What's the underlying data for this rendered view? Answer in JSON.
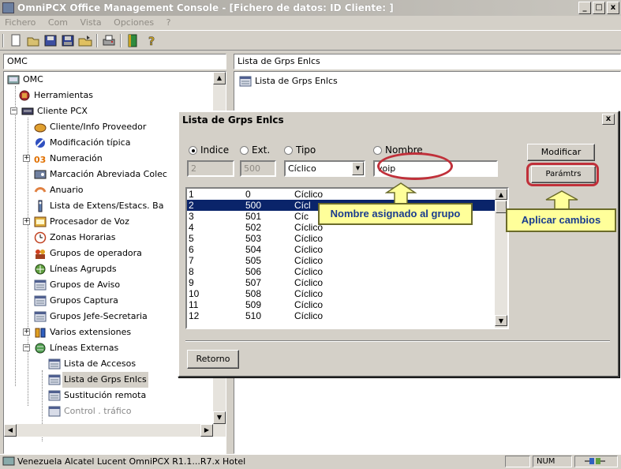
{
  "window": {
    "title": "OmniPCX Office Management Console - [Fichero de datos:     ID Cliente: ]",
    "min": "_",
    "max": "□",
    "close": "x"
  },
  "menu": [
    "Fichero",
    "Com",
    "Vista",
    "Opciones",
    "?"
  ],
  "toolbar": [
    "new-doc-icon",
    "open-folder-icon",
    "save-icon",
    "save-all-icon",
    "open-icon",
    "print-icon",
    "book-icon",
    "help-icon"
  ],
  "left_header": "OMC",
  "right_header": "Lista de Grps Enlcs",
  "tree": {
    "root": "OMC",
    "items": [
      {
        "label": "Herramientas",
        "icon": "tools-icon"
      },
      {
        "label": "Cliente PCX",
        "icon": "pcx-icon"
      },
      {
        "label": "Cliente/Info Proveedor",
        "icon": "info-icon"
      },
      {
        "label": "Modificación típica",
        "icon": "modify-icon"
      },
      {
        "label": "Numeración",
        "icon": "numbering-icon"
      },
      {
        "label": "Marcación Abreviada Colec",
        "icon": "speed-dial-icon"
      },
      {
        "label": "Anuario",
        "icon": "directory-icon"
      },
      {
        "label": "Lista de Extens/Estacs. Ba",
        "icon": "extensions-icon"
      },
      {
        "label": "Procesador de Voz",
        "icon": "voice-processor-icon"
      },
      {
        "label": "Zonas Horarias",
        "icon": "clock-icon"
      },
      {
        "label": "Grupos de operadora",
        "icon": "operator-group-icon"
      },
      {
        "label": "Líneas Agrupds",
        "icon": "grouped-lines-icon"
      },
      {
        "label": "Grupos de Aviso",
        "icon": "list-icon"
      },
      {
        "label": "Grupos Captura",
        "icon": "list-icon"
      },
      {
        "label": "Grupos Jefe-Secretaria",
        "icon": "list-icon"
      },
      {
        "label": "Varios extensiones",
        "icon": "multi-extension-icon"
      },
      {
        "label": "Líneas Externas",
        "icon": "external-lines-icon"
      },
      {
        "label": "Lista de Accesos",
        "icon": "list-icon"
      },
      {
        "label": "Lista de Grps Enlcs",
        "icon": "list-icon"
      },
      {
        "label": "Sustitución remota",
        "icon": "list-icon"
      },
      {
        "label": "Control . tráfico",
        "icon": "list-icon"
      }
    ]
  },
  "right_pane": {
    "item": "Lista de Grps Enlcs"
  },
  "dialog": {
    "title": "Lista de Grps Enlcs",
    "close": "x",
    "radios": [
      "Indice",
      "Ext.",
      "Tipo",
      "Nombre"
    ],
    "selected_radio": "Indice",
    "fields": {
      "indice": "2",
      "ext": "500",
      "tipo": "Cíclico",
      "nombre": "voip"
    },
    "buttons": {
      "modificar": "Modificar",
      "paramtrs": "Parámtrs",
      "retorno": "Retorno"
    },
    "rows": [
      {
        "i": "1",
        "ext": "0",
        "tipo": "Cíclico"
      },
      {
        "i": "2",
        "ext": "500",
        "tipo": "Cícl"
      },
      {
        "i": "3",
        "ext": "501",
        "tipo": "Cíc"
      },
      {
        "i": "4",
        "ext": "502",
        "tipo": "Cíclico"
      },
      {
        "i": "5",
        "ext": "503",
        "tipo": "Cíclico"
      },
      {
        "i": "6",
        "ext": "504",
        "tipo": "Cíclico"
      },
      {
        "i": "7",
        "ext": "505",
        "tipo": "Cíclico"
      },
      {
        "i": "8",
        "ext": "506",
        "tipo": "Cíclico"
      },
      {
        "i": "9",
        "ext": "507",
        "tipo": "Cíclico"
      },
      {
        "i": "10",
        "ext": "508",
        "tipo": "Cíclico"
      },
      {
        "i": "11",
        "ext": "509",
        "tipo": "Cíclico"
      },
      {
        "i": "12",
        "ext": "510",
        "tipo": "Cíclico"
      }
    ],
    "selected_row": 1
  },
  "annotations": {
    "nombre_callout": "Nombre asignado al grupo",
    "aplicar_callout": "Aplicar cambios"
  },
  "status": {
    "text": "Venezuela Alcatel Lucent OmniPCX R1.1...R7.x Hotel",
    "num": "NUM"
  },
  "colors": {
    "selection": "#0a246a",
    "callout_bg": "#ffff9a",
    "highlight": "#c0303a",
    "arrow": "#ffff9a"
  }
}
